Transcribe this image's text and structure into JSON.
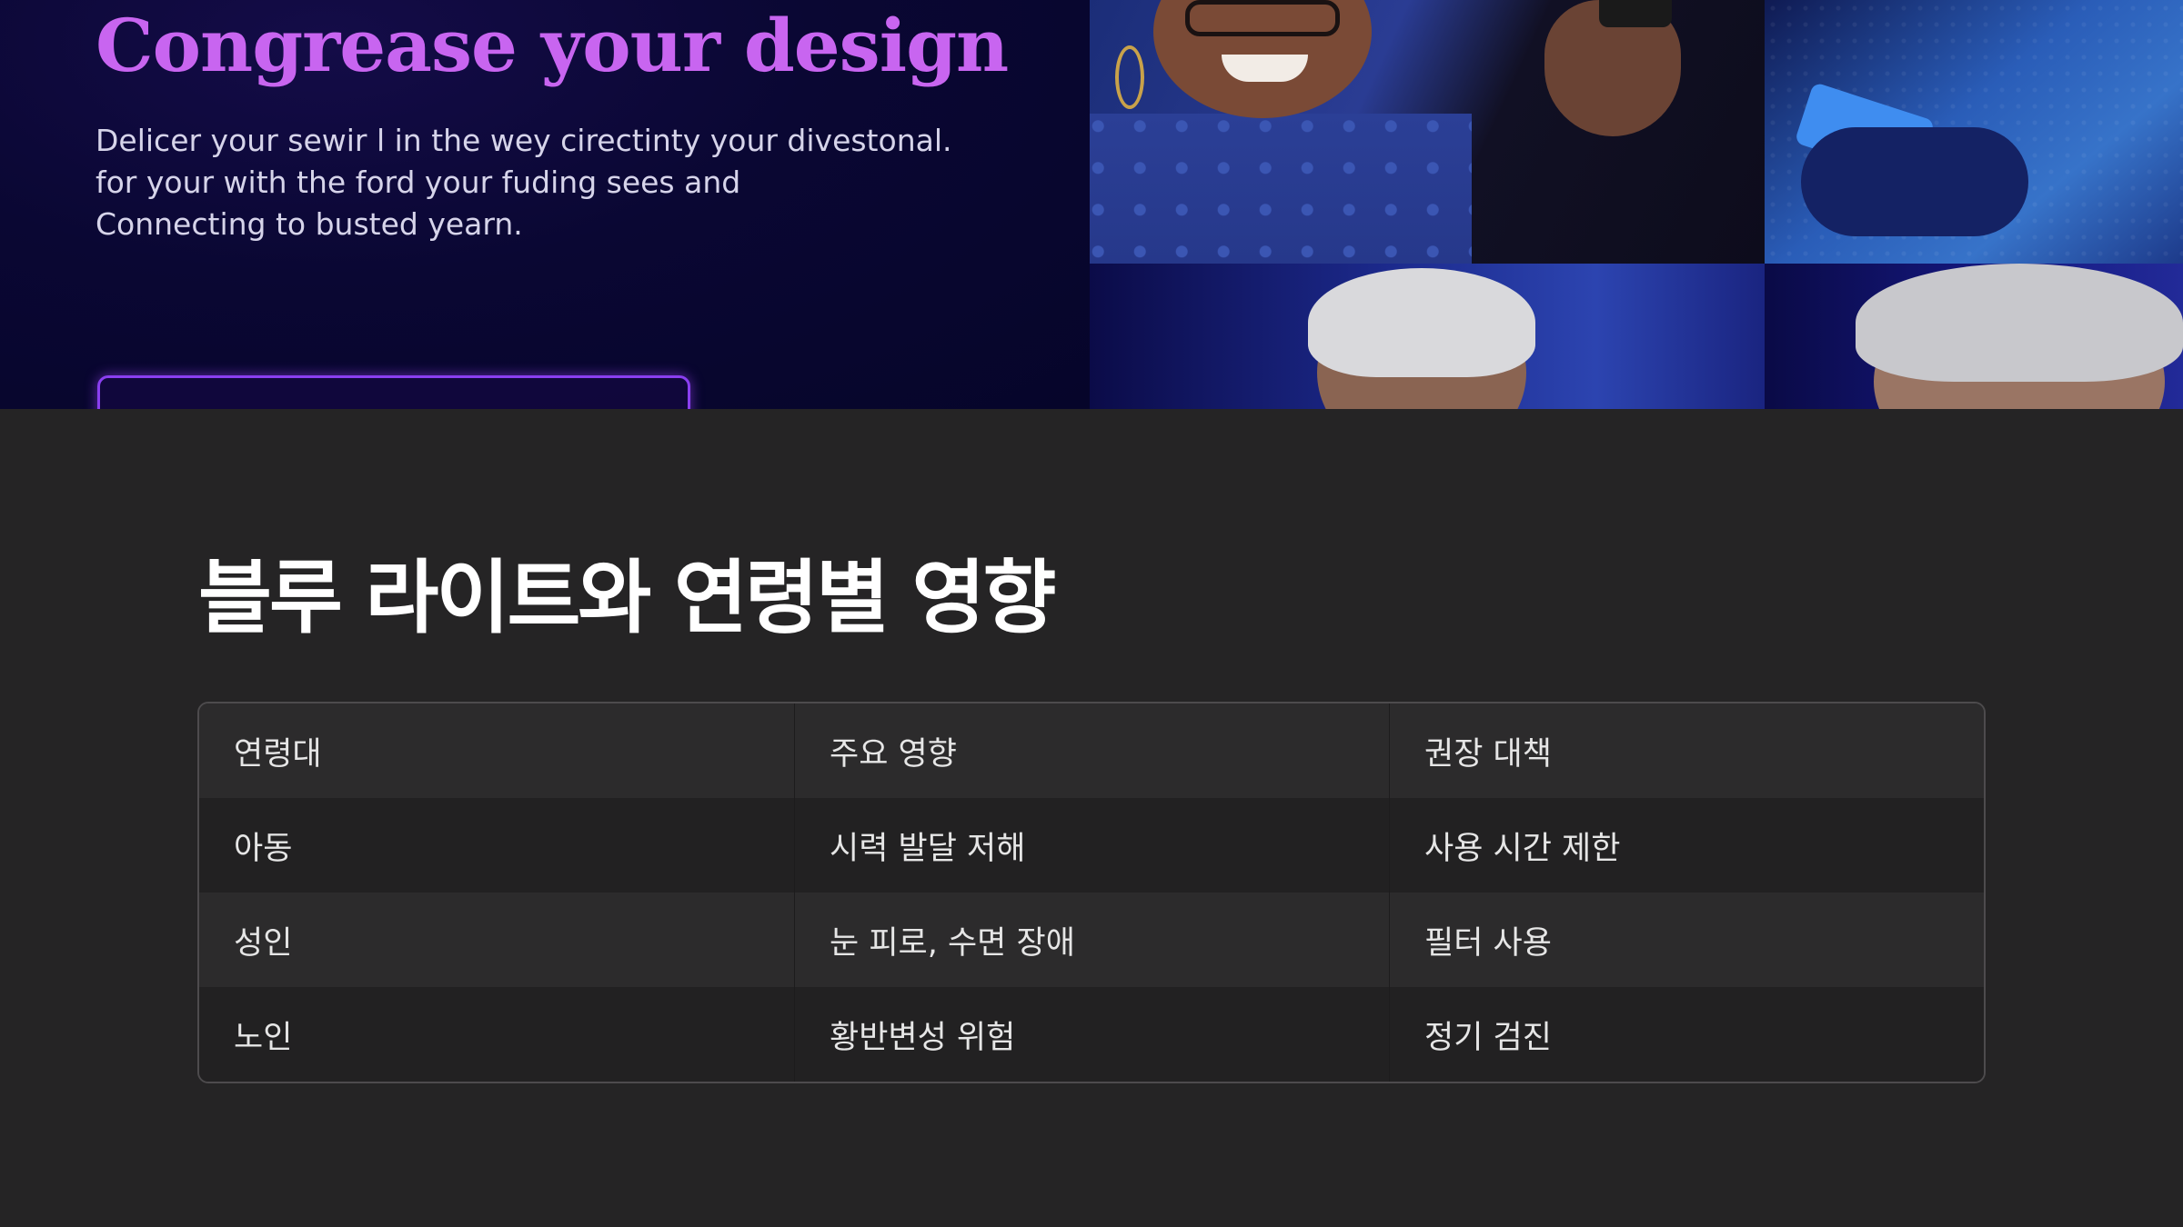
{
  "hero": {
    "title": "Congrease your design",
    "body_lines": [
      "Delicer your sewir l in the wey cirectinty your divestonal.",
      "for your with the ford your fuding sees and",
      "Connecting to busted yearn."
    ],
    "accent_color": "#c865f0",
    "background_color": "#0a0733"
  },
  "section": {
    "title": "블루 라이트와 연령별 영향"
  },
  "table": {
    "headers": [
      "연령대",
      "주요 영향",
      "권장 대책"
    ],
    "rows": [
      [
        "아동",
        "시력 발달 저해",
        "사용 시간 제한"
      ],
      [
        "성인",
        "눈 피로, 수면 장애",
        "필터 사용"
      ],
      [
        "노인",
        "황반변성 위험",
        "정기 검진"
      ]
    ]
  },
  "colors": {
    "page_background": "#252425",
    "table_border": "#4d4b4d",
    "row_light": "#2c2b2c",
    "row_dark": "#222122",
    "text": "#e6e6e6",
    "cta_border": "#8a3ff0"
  }
}
